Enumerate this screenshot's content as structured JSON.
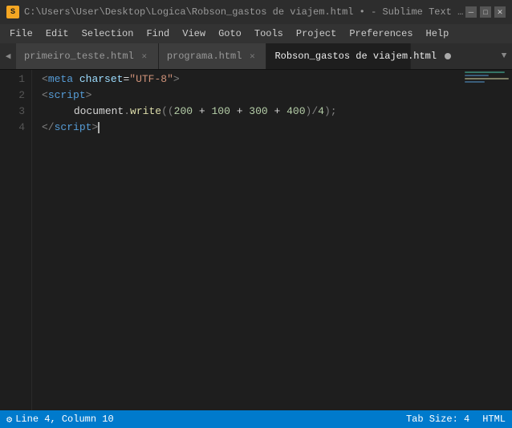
{
  "titlebar": {
    "icon": "S",
    "title": "C:\\Users\\User\\Desktop\\Logica\\Robson_gastos de viajem.html • - Sublime Text (UNREGI...",
    "minimize": "─",
    "maximize": "□",
    "close": "✕"
  },
  "menubar": {
    "items": [
      "File",
      "Edit",
      "Selection",
      "Find",
      "View",
      "Goto",
      "Tools",
      "Project",
      "Preferences",
      "Help"
    ]
  },
  "tabs": [
    {
      "id": "tab1",
      "label": "primeiro_teste.html",
      "active": false,
      "dot": false
    },
    {
      "id": "tab2",
      "label": "programa.html",
      "active": false,
      "dot": false
    },
    {
      "id": "tab3",
      "label": "Robson_gastos de viajem.html",
      "active": true,
      "dot": true
    }
  ],
  "editor": {
    "lines": [
      {
        "num": 1,
        "content_key": "line1"
      },
      {
        "num": 2,
        "content_key": "line2"
      },
      {
        "num": 3,
        "content_key": "line3"
      },
      {
        "num": 4,
        "content_key": "line4"
      }
    ]
  },
  "statusbar": {
    "position": "Line 4, Column 10",
    "tab_size": "Tab Size: 4",
    "language": "HTML"
  },
  "minimap": {
    "lines": [
      {
        "color": "#4ec9b0",
        "width": 50
      },
      {
        "color": "#569cd6",
        "width": 30
      },
      {
        "color": "#dcdcaa",
        "width": 55
      },
      {
        "color": "#569cd6",
        "width": 25
      }
    ]
  }
}
